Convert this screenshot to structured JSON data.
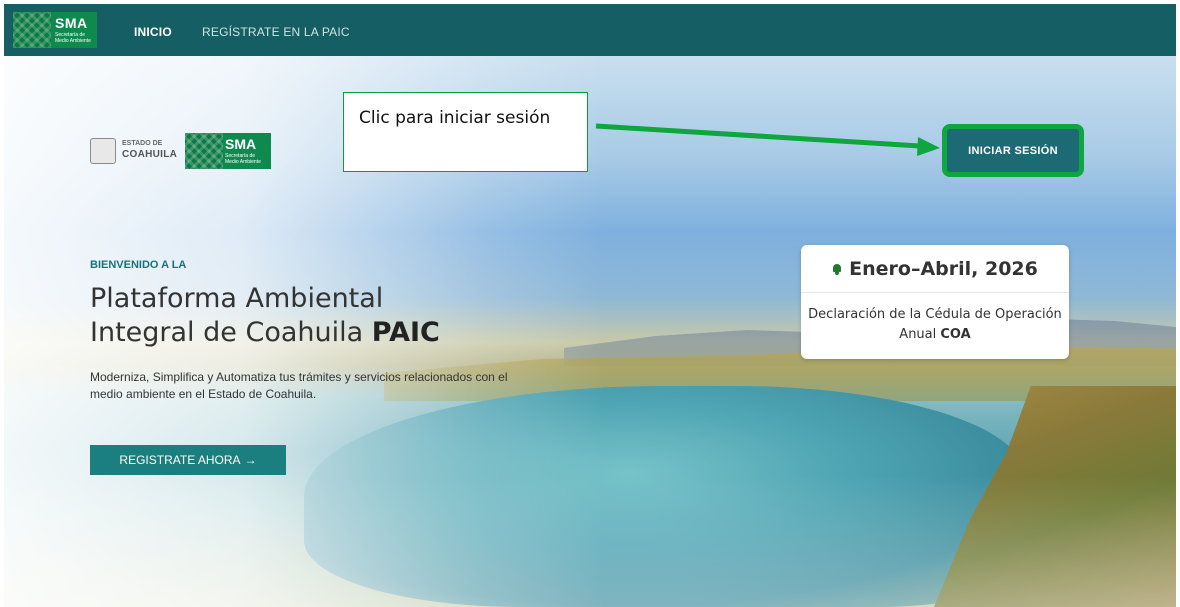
{
  "nav": {
    "logo": {
      "abbr": "SMA",
      "subtitle": "Secretaría de Medio Ambiente"
    },
    "links": [
      "INICIO",
      "REGÍSTRATE EN LA PAIC"
    ]
  },
  "partners": {
    "estado": {
      "line1": "ESTADO DE",
      "line2": "COAHUILA"
    },
    "sma": {
      "abbr": "SMA",
      "subtitle": "Secretaría de Medio Ambiente"
    }
  },
  "annotation": {
    "text": "Clic para iniciar sesión",
    "color": "#0ea63f"
  },
  "login_button": "INICIAR SESIÓN",
  "hero": {
    "eyebrow": "BIENVENIDO A LA",
    "title_line1": "Plataforma Ambiental",
    "title_line2": "Integral de Coahuila",
    "title_bold": "PAIC",
    "description": "Moderniza, Simplifica y Automatiza tus trámites y servicios relacionados con el medio ambiente en el Estado de Coahuila.",
    "cta": "REGISTRATE AHORA",
    "cta_icon": "→"
  },
  "event": {
    "icon": "bell-icon",
    "title": "Enero–Abril, 2026",
    "body": "Declaración de la Cédula de Operación Anual",
    "body_bold": "COA"
  },
  "colors": {
    "nav_bg": "#155e63",
    "brand_green": "#0e8a4e",
    "accent_teal": "#1c7f7f"
  }
}
